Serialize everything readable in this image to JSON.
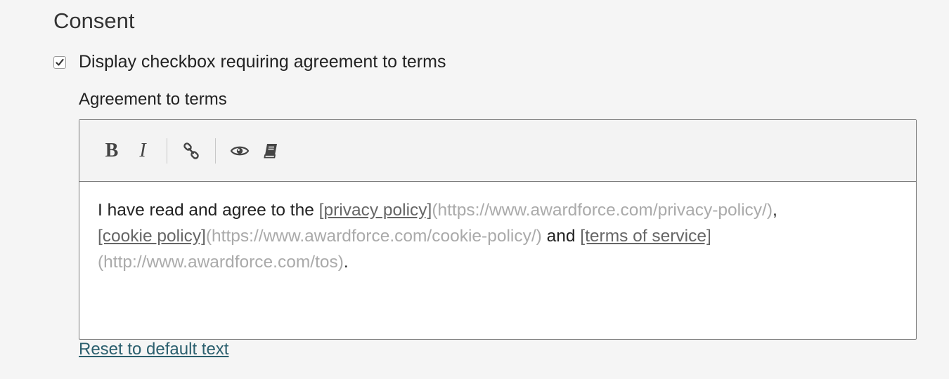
{
  "section": {
    "title": "Consent"
  },
  "consent": {
    "checkbox_checked": true,
    "checkbox_label": "Display checkbox requiring agreement to terms"
  },
  "agreement": {
    "label": "Agreement to terms",
    "toolbar": {
      "bold_label": "B",
      "italic_label": "I",
      "link_icon": "link-icon",
      "preview_icon": "eye-icon",
      "guide_icon": "book-icon"
    },
    "content": {
      "part1": "I have read and agree to the ",
      "link1_text": "[privacy policy]",
      "link1_url": "(https://www.awardforce.com/privacy-policy/)",
      "sep1": ",",
      "link2_text": "[cookie policy]",
      "link2_url": "(https://www.awardforce.com/cookie-policy/)",
      "sep2": " and ",
      "link3_text": "[terms of service]",
      "link3_url": "(http://www.awardforce.com/tos)",
      "end": "."
    },
    "reset_label": "Reset to default text"
  },
  "colors": {
    "link": "#2b5f6e",
    "markdown_url": "#aaaaaa",
    "markdown_link": "#666666"
  }
}
